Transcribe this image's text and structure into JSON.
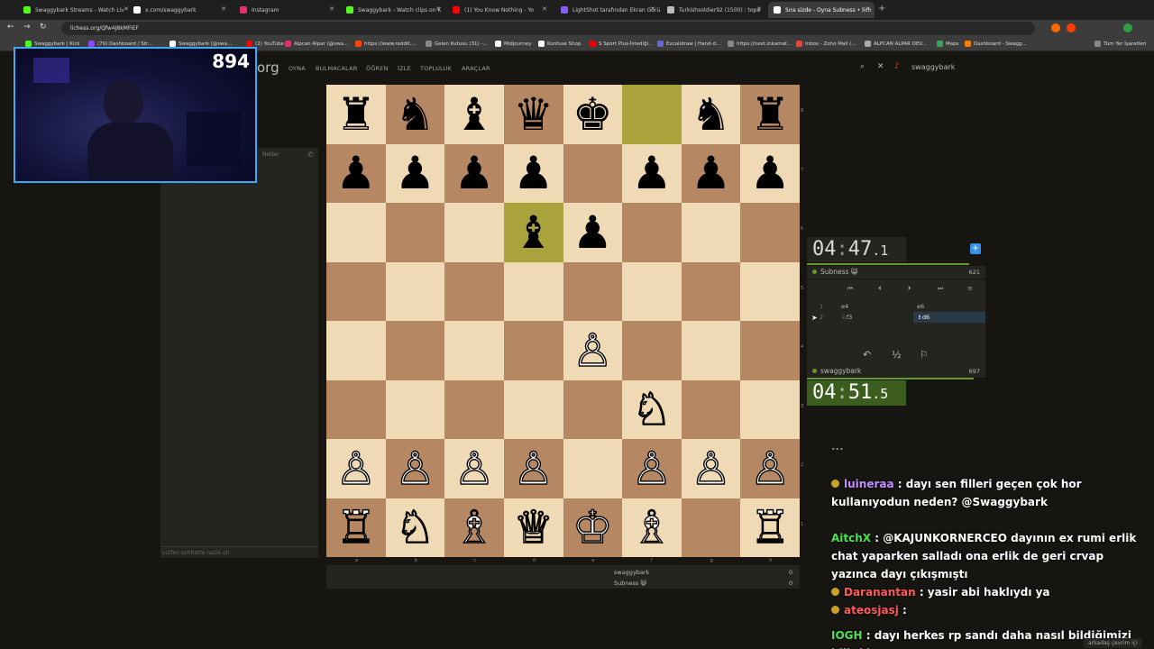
{
  "browser": {
    "tabs": [
      {
        "label": "Swaggybark Streams - Watch Liv",
        "color": "#53fc18"
      },
      {
        "label": "x.com/swaggybark",
        "color": "#ffffff"
      },
      {
        "label": "Instagram",
        "color": "#e1306c"
      },
      {
        "label": "Swaggybark - Watch clips on K",
        "color": "#53fc18"
      },
      {
        "label": "(1) You Know Nothing - Yo",
        "color": "#ff0000"
      },
      {
        "label": "LightShot tarafından Ekran Görü",
        "color": "#8a5cf6"
      },
      {
        "label": "Turkishsoldier92 (1500) : topa",
        "color": "#bbbbbb"
      },
      {
        "label": "Sıra sizde - Oyna Subness • lich",
        "color": "#ffffff"
      }
    ],
    "url": "lichess.org/Qfw4J8kMFiEF",
    "bookmarks": [
      "Swaggybark | Kick",
      "(79) Dashboard / Str...",
      "Swaggybark (@swa...",
      "(2) YouTube",
      "Alpcan Alpar (@swa...",
      "https://www.reddit....",
      "Gelen Kutusu (31) -...",
      "Midjourney",
      "Konfuse Shop",
      "S Sport Plus-İstediği...",
      "Excalidraw | Hand-d...",
      "https://next.inkamat...",
      "Inbox - Zoho Mail (...",
      "ALPCAN ALPAR DEV...",
      "Maps",
      "Dashboard - Swagg...",
      "Tüm Yer İşaretleri"
    ]
  },
  "site": {
    "logo_suffix": "org",
    "nav": [
      "OYNA",
      "BULMACALAR",
      "ÖĞREN",
      "İZLE",
      "TOPLULUK",
      "ARAÇLAR"
    ],
    "username": "swaggybark"
  },
  "left_panel": {
    "notes_label": "Notlar",
    "chat_placeholder": "Lütfen sohbette nazik ol!"
  },
  "webcam": {
    "viewer_count": "894"
  },
  "board": {
    "ranks": [
      "8",
      "7",
      "6",
      "5",
      "4",
      "3",
      "2",
      "1"
    ],
    "files": [
      "a",
      "b",
      "c",
      "d",
      "e",
      "f",
      "g",
      "h"
    ],
    "squares": [
      [
        "♜b",
        "♞b",
        "♝b",
        "♛b",
        "♚b",
        "",
        "♞b",
        "♜b"
      ],
      [
        "♟b",
        "♟b",
        "♟b",
        "♟b",
        "",
        "♟b",
        "♟b",
        "♟b"
      ],
      [
        "",
        "",
        "",
        "♝b",
        "♟b",
        "",
        "",
        ""
      ],
      [
        "",
        "",
        "",
        "",
        "",
        "",
        "",
        ""
      ],
      [
        "",
        "",
        "",
        "",
        "♙w",
        "",
        "",
        ""
      ],
      [
        "",
        "",
        "",
        "",
        "",
        "♘w",
        "",
        ""
      ],
      [
        "♙w",
        "♙w",
        "♙w",
        "♙w",
        "",
        "♙w",
        "♙w",
        "♙w"
      ],
      [
        "♖w",
        "♘w",
        "♗w",
        "♕w",
        "♔w",
        "♗w",
        "",
        ""
      ]
    ],
    "h1_piece": "♖w",
    "highlight": [
      "f8",
      "d6"
    ]
  },
  "score": {
    "rows": [
      {
        "name": "swaggybark",
        "score": "0"
      },
      {
        "name": "Subness 😸",
        "score": "0"
      }
    ]
  },
  "opponent": {
    "name": "Subness 😸",
    "rating": "621",
    "clock_main": "04",
    "clock_sec": "47",
    "clock_tenths": "1"
  },
  "player": {
    "name": "swaggybark",
    "rating": "697",
    "clock_main": "04",
    "clock_sec": "51",
    "clock_tenths": "5"
  },
  "moves": [
    {
      "num": "1",
      "white": "e4",
      "black": "e6"
    },
    {
      "num": "2",
      "white": "♘f3",
      "black": "♗d6"
    }
  ],
  "controls": {
    "first": "⏮",
    "prev": "⏴",
    "next": "⏵",
    "last": "⏭",
    "menu": "≡",
    "takeback": "↶",
    "draw": "½",
    "resign": "⚐",
    "add_time": "+"
  },
  "chat": [
    {
      "user": "",
      "text": "...",
      "color": "#e7e76b"
    },
    {
      "user": "luineraa",
      "text": ": dayı sen filleri geçen çok hor kullanıyodun neden? @Swaggybark",
      "color": "#c38eff"
    },
    {
      "user": "AitchX",
      "text": ": @KAJUNKORNERCEO dayının ex rumi erlik chat yaparken salladı ona erlik de geri crvap yazınca dayı çıkışmıştı",
      "color": "#4ce44c"
    },
    {
      "user": "Daranantan",
      "text": ": yasir abi haklıydı ya",
      "color": "#ff5a5a"
    },
    {
      "user": "ateosjasj",
      "text": ":",
      "color": "#ff5a5a"
    },
    {
      "user": "IOGH",
      "text": ": dayı herkes rp sandı daha nasıl bildiğimizi bilir ki",
      "color": "#4ce44c"
    }
  ],
  "friends_label": "arkadaş çevrim içi"
}
